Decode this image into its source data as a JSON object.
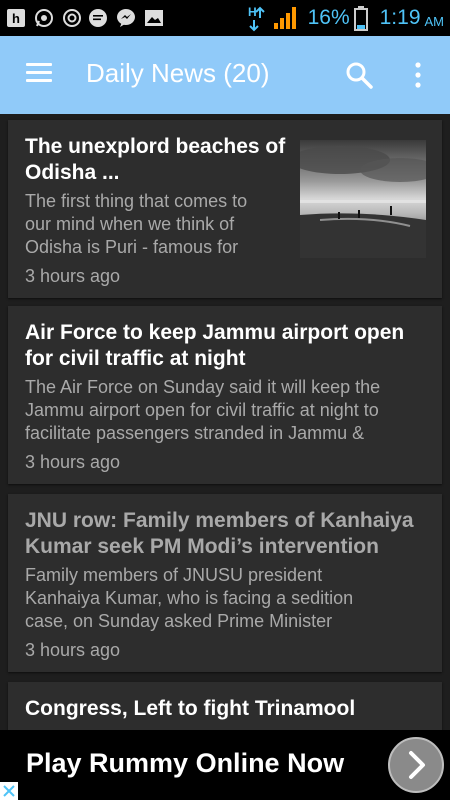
{
  "status_bar": {
    "signal_indicator": "H",
    "battery_percent": "16%",
    "time": "1:19",
    "ampm": "AM",
    "icons": [
      "h-app-icon",
      "whatsapp-icon",
      "app-a-icon",
      "chat-bubble-icon",
      "messenger-icon",
      "gallery-icon",
      "hplus-signal-icon",
      "cell-signal-icon",
      "battery-icon"
    ]
  },
  "app_bar": {
    "title": "Daily News (20)",
    "background": "#90caf9"
  },
  "articles": [
    {
      "headline_line1": "The unexplord beaches of",
      "headline_line2": "Odisha ...",
      "summary": [
        "The first thing that comes to",
        "our mind when we think of",
        "Odisha is Puri - famous for"
      ],
      "time": "3 hours ago",
      "has_image": true,
      "headline_color": "#ffffff"
    },
    {
      "headline_line1": "Air Force to keep Jammu airport open",
      "headline_line2": "for civil traffic at night",
      "summary": [
        "The Air Force on Sunday said it will keep the",
        "Jammu airport open for civil traffic at night to",
        "facilitate passengers stranded in Jammu &"
      ],
      "time": "3 hours ago",
      "has_image": false,
      "headline_color": "#ffffff"
    },
    {
      "headline_line1": "JNU row: Family members of Kanhaiya",
      "headline_line2": "Kumar seek PM Modi’s intervention",
      "summary": [
        "Family members of JNUSU president",
        "Kanhaiya Kumar, who is facing a sedition",
        "case, on Sunday asked Prime Minister"
      ],
      "time": "3 hours ago",
      "has_image": false,
      "headline_color": "#a9a9a9"
    },
    {
      "headline_line1": "Congress, Left to fight Trinamool",
      "headline_line2": "",
      "summary": [],
      "time": "",
      "has_image": false,
      "headline_color": "#ffffff"
    }
  ],
  "ad": {
    "text": "Play Rummy Online Now"
  }
}
